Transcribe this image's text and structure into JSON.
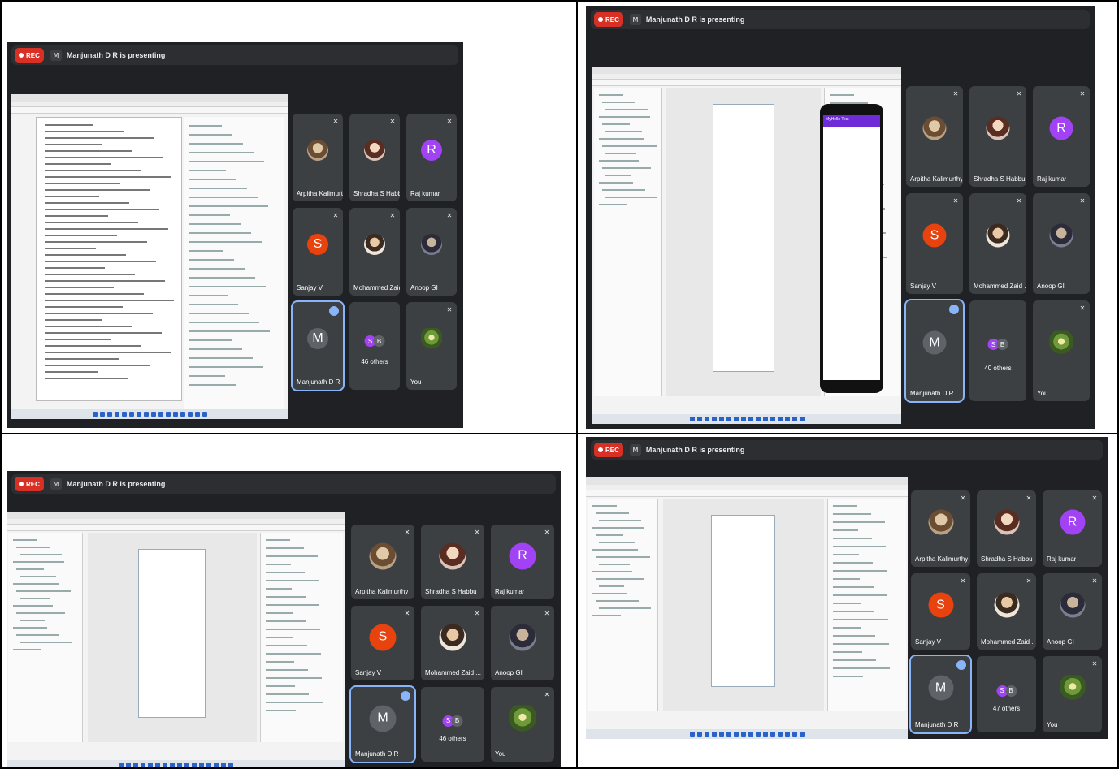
{
  "colors": {
    "meet_bg": "#202124",
    "tile_bg": "#3c4043",
    "rec_red": "#d93025",
    "active_blue": "#8ab4f8",
    "avatar_orange": "#e8430e",
    "avatar_purple": "#a142f4",
    "avatar_gray": "#5f6368"
  },
  "icons": [
    "record-dot-icon",
    "microphone-muted-icon",
    "speaking-indicator-icon",
    "taskbar-app-icon"
  ],
  "panels": [
    {
      "rec": "REC",
      "presenter_initial": "M",
      "presenting_text": "Manjunath D R is presenting",
      "content": "document",
      "participants": [
        {
          "name": "Arpitha Kalimurthy",
          "avatar": "photo"
        },
        {
          "name": "Shradha S Habbu",
          "avatar": "photo2"
        },
        {
          "name": "Raj kumar",
          "avatar": "letter",
          "letter": "R",
          "color": "#a142f4"
        },
        {
          "name": "Sanjay V",
          "avatar": "letter",
          "letter": "S",
          "color": "#e8430e"
        },
        {
          "name": "Mohammed Zaid ...",
          "avatar": "photo3"
        },
        {
          "name": "Anoop GI",
          "avatar": "photo4"
        },
        {
          "name": "Manjunath D R",
          "avatar": "letter",
          "letter": "M",
          "color": "#5f6368",
          "active": true
        },
        {
          "others": "46 others",
          "minis": [
            "S",
            "B"
          ]
        },
        {
          "name": "You",
          "avatar": "flower"
        }
      ]
    },
    {
      "rec": "REC",
      "presenter_initial": "M",
      "presenting_text": "Manjunath D R is presenting",
      "content": "ide-phone",
      "phone_title": "MyHello Test",
      "participants": [
        {
          "name": "Arpitha Kalimurthy",
          "avatar": "photo"
        },
        {
          "name": "Shradha S Habbu",
          "avatar": "photo2"
        },
        {
          "name": "Raj kumar",
          "avatar": "letter",
          "letter": "R",
          "color": "#a142f4"
        },
        {
          "name": "Sanjay V",
          "avatar": "letter",
          "letter": "S",
          "color": "#e8430e"
        },
        {
          "name": "Mohammed Zaid ...",
          "avatar": "photo3"
        },
        {
          "name": "Anoop GI",
          "avatar": "photo4"
        },
        {
          "name": "Manjunath D R",
          "avatar": "letter",
          "letter": "M",
          "color": "#5f6368",
          "active": true
        },
        {
          "others": "40 others",
          "minis": [
            "S",
            "B"
          ]
        },
        {
          "name": "You",
          "avatar": "flower"
        }
      ]
    },
    {
      "rec": "REC",
      "presenter_initial": "M",
      "presenting_text": "Manjunath D R is presenting",
      "content": "ide-design",
      "participants": [
        {
          "name": "Arpitha Kalimurthy",
          "avatar": "photo"
        },
        {
          "name": "Shradha S Habbu",
          "avatar": "photo2"
        },
        {
          "name": "Raj kumar",
          "avatar": "letter",
          "letter": "R",
          "color": "#a142f4"
        },
        {
          "name": "Sanjay V",
          "avatar": "letter",
          "letter": "S",
          "color": "#e8430e"
        },
        {
          "name": "Mohammed Zaid ...",
          "avatar": "photo3"
        },
        {
          "name": "Anoop GI",
          "avatar": "photo4"
        },
        {
          "name": "Manjunath D R",
          "avatar": "letter",
          "letter": "M",
          "color": "#5f6368",
          "active": true
        },
        {
          "others": "46 others",
          "minis": [
            "S",
            "B"
          ]
        },
        {
          "name": "You",
          "avatar": "flower"
        }
      ]
    },
    {
      "rec": "REC",
      "presenter_initial": "M",
      "presenting_text": "Manjunath D R is presenting",
      "content": "ide-layout",
      "participants": [
        {
          "name": "Arpitha Kalimurthy",
          "avatar": "photo"
        },
        {
          "name": "Shradha S Habbu",
          "avatar": "photo2"
        },
        {
          "name": "Raj kumar",
          "avatar": "letter",
          "letter": "R",
          "color": "#a142f4"
        },
        {
          "name": "Sanjay V",
          "avatar": "letter",
          "letter": "S",
          "color": "#e8430e"
        },
        {
          "name": "Mohammed Zaid ...",
          "avatar": "photo3"
        },
        {
          "name": "Anoop GI",
          "avatar": "photo4"
        },
        {
          "name": "Manjunath D R",
          "avatar": "letter",
          "letter": "M",
          "color": "#5f6368",
          "active": true
        },
        {
          "others": "47 others",
          "minis": [
            "S",
            "B"
          ]
        },
        {
          "name": "You",
          "avatar": "flower"
        }
      ]
    }
  ]
}
